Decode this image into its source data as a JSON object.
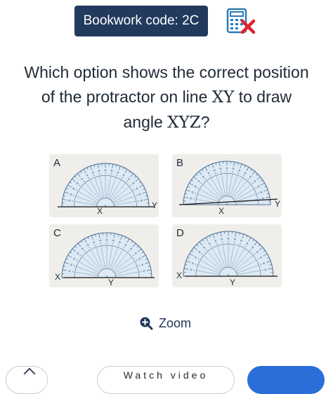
{
  "header": {
    "bookwork_label": "Bookwork code: 2C",
    "calculator_icon": "calculator-not-allowed-icon",
    "icon_colors": {
      "calculator": "#2a7ab8",
      "cross": "#e0242b"
    }
  },
  "question": {
    "line1": "Which option shows the correct position",
    "line2_pre": "of the protractor on line ",
    "line2_math": "XY",
    "line2_post": " to draw",
    "line3_pre": "angle ",
    "line3_math": "XYZ",
    "line3_post": "?"
  },
  "options": [
    {
      "letter": "A",
      "left_label": "X",
      "right_label": "Y",
      "protractor_pos": "centered-on-line"
    },
    {
      "letter": "B",
      "left_label": "X",
      "right_label": "Y",
      "protractor_pos": "centered-on-line"
    },
    {
      "letter": "C",
      "left_label": "X",
      "right_label": "Y",
      "protractor_pos": "shifted-right"
    },
    {
      "letter": "D",
      "left_label": "X",
      "right_label": "Y",
      "protractor_pos": "shifted-right"
    }
  ],
  "zoom": {
    "label": "Zoom",
    "icon": "zoom-in-icon"
  },
  "bottom": {
    "watch_label": "Watch video"
  },
  "colors": {
    "badge_bg": "#223a5e",
    "protractor_fill": "#dde9f3",
    "protractor_stroke": "#4a6e94",
    "card_bg": "#efeeea",
    "accent": "#2a6fd8"
  }
}
